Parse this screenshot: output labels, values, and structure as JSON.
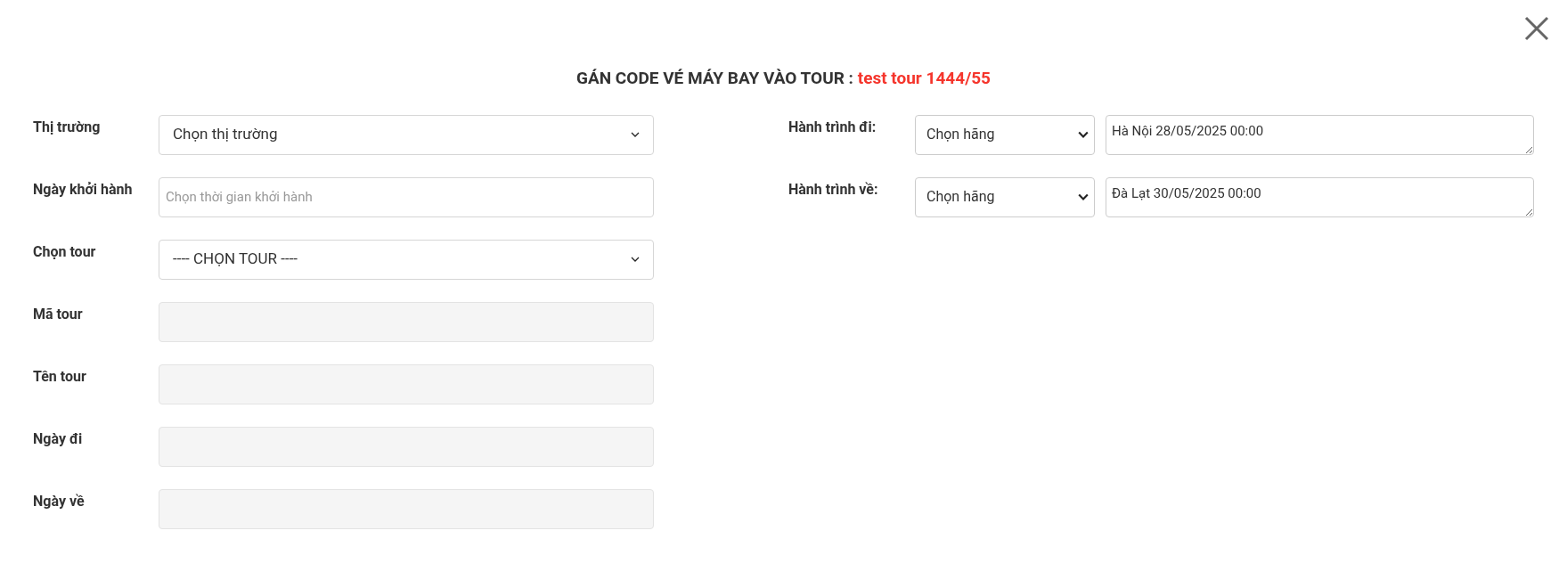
{
  "dialog": {
    "title": "GÁN CODE VÉ MÁY BAY VÀO TOUR :",
    "title_highlight": "test tour 1444/55"
  },
  "left_fields": [
    {
      "label": "Thị trường",
      "kind": "select",
      "value": "Chọn thị trường",
      "disabled": false
    },
    {
      "label": "Ngày khởi hành",
      "kind": "input",
      "placeholder": "Chọn thời gian khởi hành",
      "disabled": false
    },
    {
      "label": "Chọn tour",
      "kind": "select",
      "value": "---- CHỌN TOUR ----",
      "disabled": false
    },
    {
      "label": "Mã tour",
      "kind": "input",
      "disabled": true
    },
    {
      "label": "Tên tour",
      "kind": "input",
      "disabled": true
    },
    {
      "label": "Ngày đi",
      "kind": "input",
      "disabled": true
    },
    {
      "label": "Ngày về",
      "kind": "input",
      "disabled": true
    }
  ],
  "legs": [
    {
      "label": "Hành trình đi:",
      "airline": "Chọn hãng",
      "details": "Hà Nội 28/05/2025 00:00"
    },
    {
      "label": "Hành trình về:",
      "airline": "Chọn hãng",
      "details": "Đà Lạt 30/05/2025 00:00"
    }
  ]
}
